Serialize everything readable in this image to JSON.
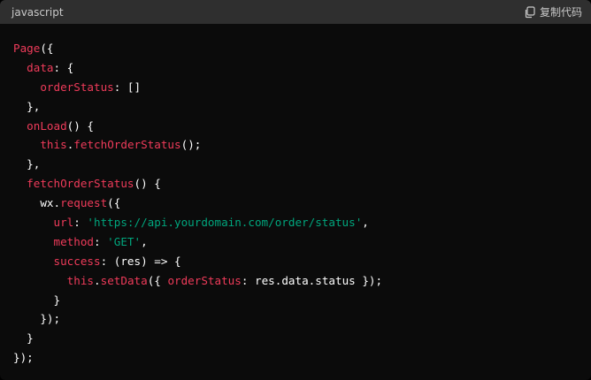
{
  "header": {
    "language": "javascript",
    "copy_label": "复制代码",
    "copy_icon": "copy-icon"
  },
  "colors": {
    "background": "#0b0b0b",
    "header_bg": "#2f2f2f",
    "identifier": "#ef3b5a",
    "string": "#00a67d",
    "plain": "#ffffff"
  },
  "code": {
    "lines": [
      [
        {
          "t": "Page",
          "k": "name"
        },
        {
          "t": "({",
          "k": "punc"
        }
      ],
      [
        {
          "t": "  ",
          "k": "punc"
        },
        {
          "t": "data",
          "k": "name"
        },
        {
          "t": ": {",
          "k": "punc"
        }
      ],
      [
        {
          "t": "    ",
          "k": "punc"
        },
        {
          "t": "orderStatus",
          "k": "name"
        },
        {
          "t": ": []",
          "k": "punc"
        }
      ],
      [
        {
          "t": "  },",
          "k": "punc"
        }
      ],
      [
        {
          "t": "  ",
          "k": "punc"
        },
        {
          "t": "onLoad",
          "k": "name"
        },
        {
          "t": "() {",
          "k": "punc"
        }
      ],
      [
        {
          "t": "    ",
          "k": "punc"
        },
        {
          "t": "this",
          "k": "name"
        },
        {
          "t": ".",
          "k": "punc"
        },
        {
          "t": "fetchOrderStatus",
          "k": "name"
        },
        {
          "t": "();",
          "k": "punc"
        }
      ],
      [
        {
          "t": "  },",
          "k": "punc"
        }
      ],
      [
        {
          "t": "  ",
          "k": "punc"
        },
        {
          "t": "fetchOrderStatus",
          "k": "name"
        },
        {
          "t": "() {",
          "k": "punc"
        }
      ],
      [
        {
          "t": "    wx.",
          "k": "punc"
        },
        {
          "t": "request",
          "k": "name"
        },
        {
          "t": "({",
          "k": "punc"
        }
      ],
      [
        {
          "t": "      ",
          "k": "punc"
        },
        {
          "t": "url",
          "k": "name"
        },
        {
          "t": ": ",
          "k": "punc"
        },
        {
          "t": "'https://api.yourdomain.com/order/status'",
          "k": "str"
        },
        {
          "t": ",",
          "k": "punc"
        }
      ],
      [
        {
          "t": "      ",
          "k": "punc"
        },
        {
          "t": "method",
          "k": "name"
        },
        {
          "t": ": ",
          "k": "punc"
        },
        {
          "t": "'GET'",
          "k": "str"
        },
        {
          "t": ",",
          "k": "punc"
        }
      ],
      [
        {
          "t": "      ",
          "k": "punc"
        },
        {
          "t": "success",
          "k": "name"
        },
        {
          "t": ": (res) => {",
          "k": "punc"
        }
      ],
      [
        {
          "t": "        ",
          "k": "punc"
        },
        {
          "t": "this",
          "k": "name"
        },
        {
          "t": ".",
          "k": "punc"
        },
        {
          "t": "setData",
          "k": "name"
        },
        {
          "t": "({ ",
          "k": "punc"
        },
        {
          "t": "orderStatus",
          "k": "name"
        },
        {
          "t": ": res.data.status });",
          "k": "punc"
        }
      ],
      [
        {
          "t": "      }",
          "k": "punc"
        }
      ],
      [
        {
          "t": "    });",
          "k": "punc"
        }
      ],
      [
        {
          "t": "  }",
          "k": "punc"
        }
      ],
      [
        {
          "t": "});",
          "k": "punc"
        }
      ]
    ]
  }
}
